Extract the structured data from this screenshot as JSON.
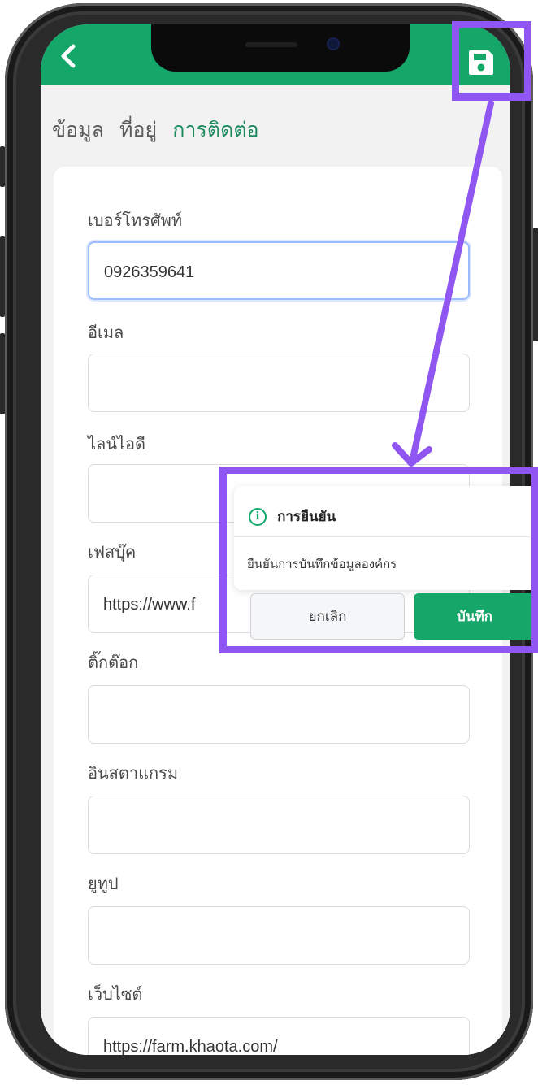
{
  "header": {
    "back_icon": "chevron-left-icon",
    "save_icon": "floppy-disk-icon",
    "color": "#15a66a"
  },
  "tabs": [
    {
      "label": "ข้อมูล",
      "active": false
    },
    {
      "label": "ที่อยู่",
      "active": false
    },
    {
      "label": "การติดต่อ",
      "active": true
    }
  ],
  "fields": {
    "phone": {
      "label": "เบอร์โทรศัพท์",
      "value": "0926359641"
    },
    "email": {
      "label": "อีเมล",
      "value": ""
    },
    "line": {
      "label": "ไลน์ไอดี",
      "value": ""
    },
    "facebook": {
      "label": "เฟสบุ๊ค",
      "value": "https://www.f"
    },
    "tiktok": {
      "label": "ติ๊กต๊อก",
      "value": ""
    },
    "instagram": {
      "label": "อินสตาแกรม",
      "value": ""
    },
    "youtube": {
      "label": "ยูทูป",
      "value": ""
    },
    "website": {
      "label": "เว็บไซต์",
      "value": "https://farm.khaota.com/"
    }
  },
  "dialog": {
    "icon": "info-icon",
    "title": "การยืนยัน",
    "message": "ยืนยันการบันทึกข้อมูลองค์กร",
    "cancel_label": "ยกเลิก",
    "confirm_label": "บันทึก"
  },
  "annotation_color": "#8f56f2"
}
